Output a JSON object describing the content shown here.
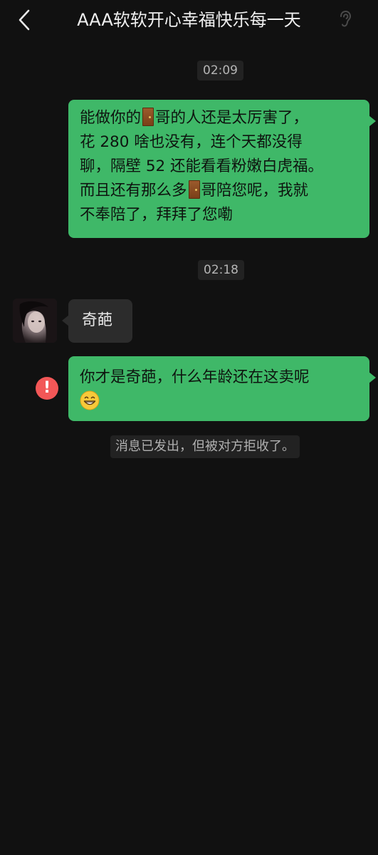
{
  "header": {
    "title": "AAA软软开心幸福快乐每一天",
    "back_icon": "chevron-left-icon",
    "mode_icon": "ear-icon"
  },
  "messages": {
    "time_1": "02:09",
    "sent_1": {
      "line_1a": "能做你的",
      "line_1b": "哥的人还是太厉害了，",
      "line_2": "花 280 啥也没有，连个天都没得",
      "line_3": "聊，隔壁 52 还能看看粉嫩白虎福。",
      "line_4a": "而且还有那么多",
      "line_4b": "哥陪您呢，我就",
      "line_5": "不奉陪了，拜拜了您嘞",
      "emoji": "door-emoji"
    },
    "time_2": "02:18",
    "received_1": "奇葩",
    "sent_2": {
      "line_1": "你才是奇葩，什么年龄还在这卖呢",
      "emoji": "grinning-emoji"
    },
    "error_icon_text": "!",
    "system_notice": "消息已发出，但被对方拒收了。"
  },
  "colors": {
    "background": "#111111",
    "sent_bubble": "#3fb868",
    "received_bubble": "#2c2c2c",
    "error": "#f25757"
  }
}
